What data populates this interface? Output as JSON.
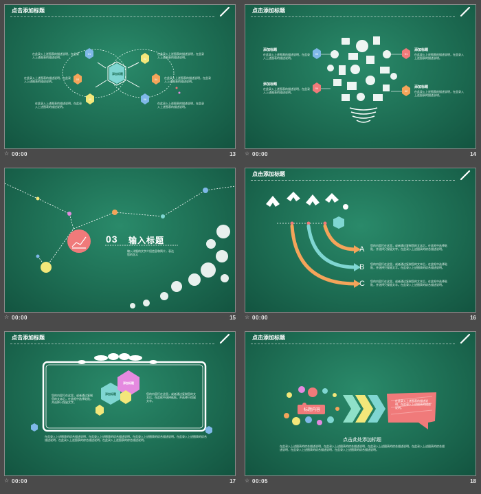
{
  "slides": [
    {
      "number": "13",
      "time": "00:00",
      "title": "点击添加标题",
      "center_label": "添加标题",
      "badges": [
        "01",
        "02",
        "03",
        "04",
        "05",
        "06"
      ],
      "texts": [
        "在此录入上述图表的描述说明，在此录入上述图表的描述说明。",
        "在此录入上述图表的描述说明，在此录入上述图表的描述说明。",
        "在此录入上述图表的描述说明，在此录入上述图表的描述说明。",
        "在此录入上述图表的描述说明，在此录入上述图表的描述说明。",
        "在此录入上述图表的描述说明，在此录入上述图表的描述说明。",
        "在此录入上述图表的描述说明，在此录入上述图表的描述说明。"
      ]
    },
    {
      "number": "14",
      "time": "00:00",
      "title": "点击添加标题",
      "badges": [
        "03",
        "01",
        "04",
        "02"
      ],
      "heading": "添加标题",
      "texts": [
        "在此录入上述图表的描述说明，在此录入上述图表的描述说明。",
        "在此录入上述图表的描述说明，在此录入上述图表的描述说明。",
        "在此录入上述图表的描述说明，在此录入上述图表的描述说明。",
        "在此录入上述图表的描述说明，在此录入上述图表的描述说明。"
      ]
    },
    {
      "number": "15",
      "time": "00:00",
      "section_number": "03",
      "section_title": "输入标题",
      "section_text": "输入详细的文字介绍信息和简介，表达您的含义"
    },
    {
      "number": "16",
      "time": "00:00",
      "title": "点击添加标题",
      "letters": [
        "A",
        "B",
        "C"
      ],
      "texts": [
        "您的内容打在这里，或者通过复制您的文本后，在此框中选择粘贴，并选择只保留文字。在此录入上述图表的综合描述说明。",
        "您的内容打在这里，或者通过复制您的文本后，在此框中选择粘贴，并选择只保留文字。在此录入上述图表的综合描述说明。",
        "您的内容打在这里，或者通过复制您的文本后，在此框中选择粘贴，并选择只保留文字。在此录入上述图表的综合描述说明。"
      ]
    },
    {
      "number": "17",
      "time": "00:00",
      "title": "点击添加标题",
      "hex_labels": [
        "添加标题",
        "添加标题"
      ],
      "left_text": "您的内容打在这里，或者通过复制您的文本后，在此框中选择粘贴，并选择只保留文字。",
      "right_text": "您的内容打在这里，或者通过复制您的文本后，在此框中选择粘贴，并选择只保留文字。",
      "bottom_text": "在此录入上述图表的综合描述说明，在此录入上述图表的综合描述说明。在此录入上述图表的综合描述说明。在此录入上述图表的综合描述说明，在此录入上述图表的综合描述说明。在此录入上述图表的综合描述说明。"
    },
    {
      "number": "18",
      "time": "00:05",
      "title": "点击添加标题",
      "badge_label": "标题内容",
      "bubble_text": "在此录入上述图表的描述说明，在此录入上述图表的描述说明。",
      "heading": "点击此处添加标题",
      "body_text": "在此录入上述图表的综合描述说明，在此录入上述图表的综合描述说明，在此录入上述图表的综合描述说明。在此录入上述图表的综合描述说明，在此录入上述图表的综合描述说明，在此录入上述图表的综合描述说明。"
    }
  ],
  "colors": {
    "board": "#1d6d53",
    "pink": "#f07a7a",
    "orange": "#f4a45a",
    "yellow": "#f3e77a",
    "cyan": "#7fd6d2",
    "blue": "#7fb8e8",
    "mint": "#8fe0c8",
    "magenta": "#e58ae0"
  }
}
